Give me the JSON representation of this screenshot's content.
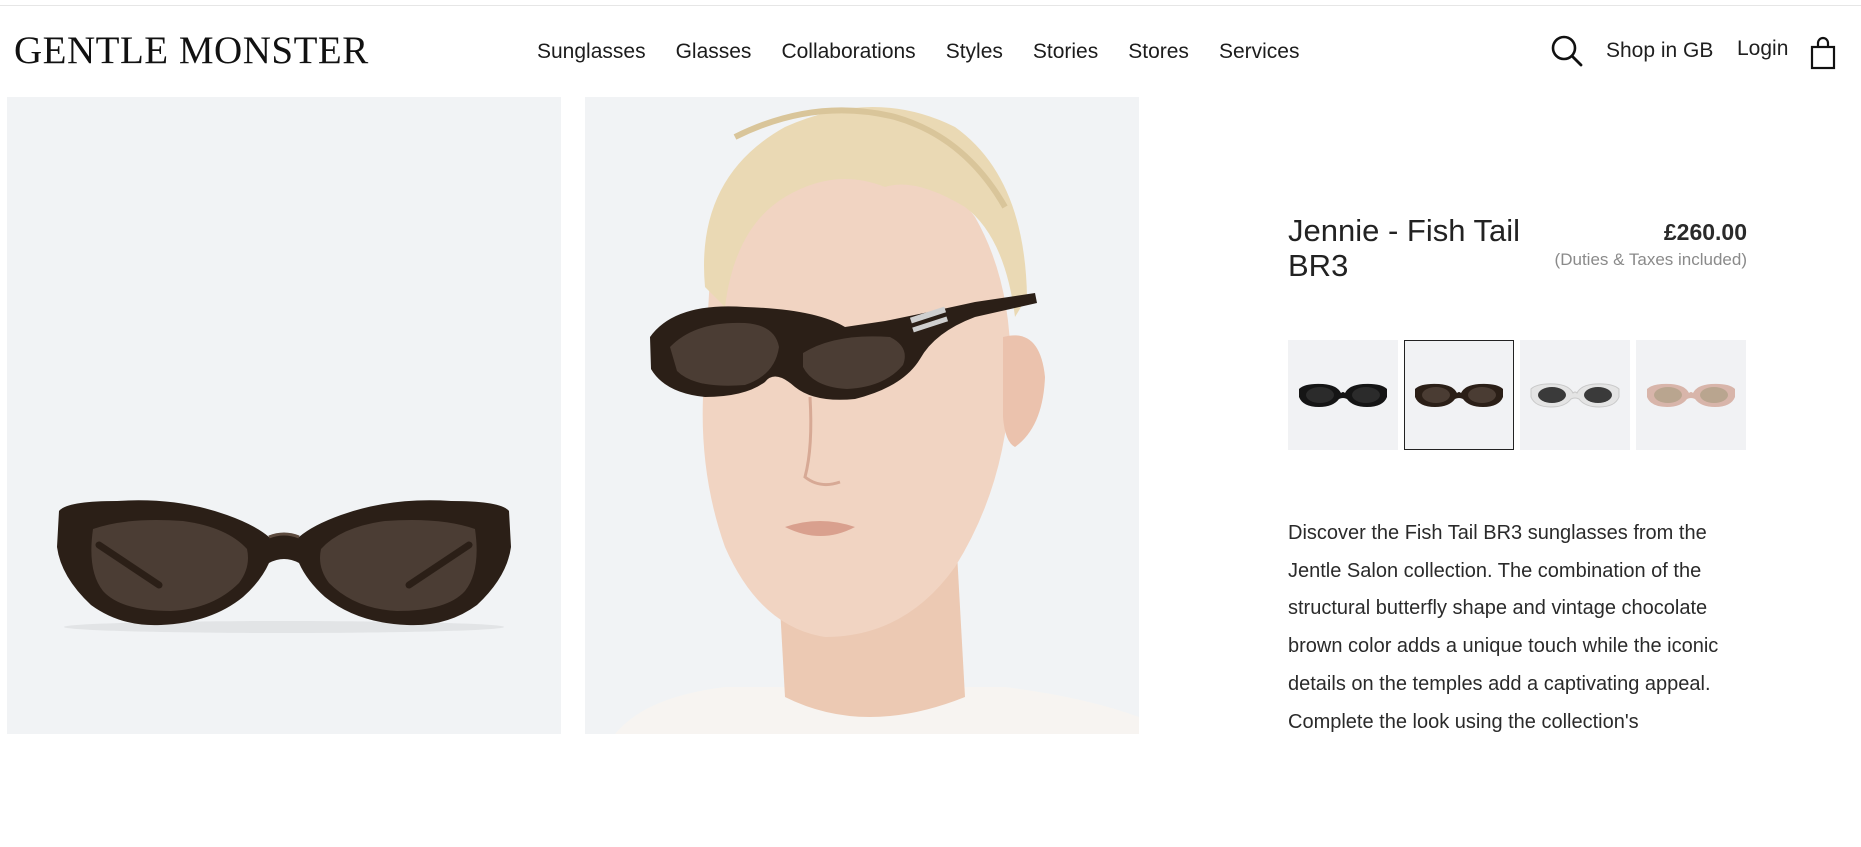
{
  "header": {
    "logo": "GENTLE MONSTER",
    "nav": [
      "Sunglasses",
      "Glasses",
      "Collaborations",
      "Styles",
      "Stories",
      "Stores",
      "Services"
    ],
    "shop_region": "Shop in GB",
    "login": "Login",
    "icons": {
      "search": "search-icon",
      "bag": "shopping-bag-icon"
    }
  },
  "product": {
    "title": "Jennie - Fish Tail BR3",
    "price": "£260.00",
    "price_note": "(Duties & Taxes included)",
    "swatches": [
      {
        "color": "black",
        "frame": "#151515",
        "lens": "#2b2b2b",
        "selected": false
      },
      {
        "color": "brown",
        "frame": "#2b1f17",
        "lens": "#4a3c33",
        "selected": true
      },
      {
        "color": "clear",
        "frame": "#e9e9e9",
        "lens": "#3a3a3a",
        "selected": false
      },
      {
        "color": "pink",
        "frame": "#d8b5aa",
        "lens": "#b9a58f",
        "selected": false
      }
    ],
    "description": "Discover the Fish Tail BR3 sunglasses from the Jentle Salon collection. The combination of the structural butterfly shape and vintage chocolate brown color adds a unique touch while the iconic details on the temples add a captivating appeal. Complete the look using the collection's"
  },
  "colors": {
    "frame_brown": "#2b1f17",
    "lens_brown": "#4b3d34",
    "panel_bg": "#f1f3f5"
  }
}
